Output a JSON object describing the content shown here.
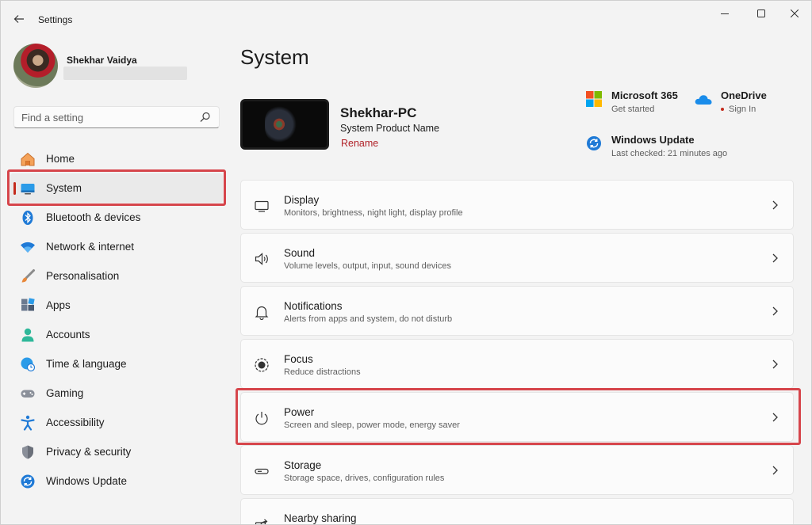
{
  "window": {
    "title": "Settings"
  },
  "profile": {
    "name": "Shekhar Vaidya"
  },
  "search": {
    "placeholder": "Find a setting"
  },
  "sidebar": {
    "items": [
      {
        "label": "Home",
        "icon": "home-icon",
        "active": false
      },
      {
        "label": "System",
        "icon": "system-icon",
        "active": true
      },
      {
        "label": "Bluetooth & devices",
        "icon": "bluetooth-icon",
        "active": false
      },
      {
        "label": "Network & internet",
        "icon": "wifi-icon",
        "active": false
      },
      {
        "label": "Personalisation",
        "icon": "brush-icon",
        "active": false
      },
      {
        "label": "Apps",
        "icon": "apps-icon",
        "active": false
      },
      {
        "label": "Accounts",
        "icon": "accounts-icon",
        "active": false
      },
      {
        "label": "Time & language",
        "icon": "clock-globe-icon",
        "active": false
      },
      {
        "label": "Gaming",
        "icon": "gamepad-icon",
        "active": false
      },
      {
        "label": "Accessibility",
        "icon": "accessibility-icon",
        "active": false
      },
      {
        "label": "Privacy & security",
        "icon": "shield-icon",
        "active": false
      },
      {
        "label": "Windows Update",
        "icon": "update-icon",
        "active": false
      }
    ]
  },
  "main": {
    "title": "System",
    "device": {
      "name": "Shekhar-PC",
      "model": "System Product Name",
      "rename": "Rename"
    },
    "quick": {
      "m365": {
        "title": "Microsoft 365",
        "subtitle": "Get started"
      },
      "onedrive": {
        "title": "OneDrive",
        "subtitle": "Sign In"
      },
      "update": {
        "title": "Windows Update",
        "subtitle": "Last checked: 21 minutes ago"
      }
    },
    "cards": [
      {
        "title": "Display",
        "subtitle": "Monitors, brightness, night light, display profile",
        "icon": "monitor-icon"
      },
      {
        "title": "Sound",
        "subtitle": "Volume levels, output, input, sound devices",
        "icon": "speaker-icon"
      },
      {
        "title": "Notifications",
        "subtitle": "Alerts from apps and system, do not disturb",
        "icon": "bell-icon"
      },
      {
        "title": "Focus",
        "subtitle": "Reduce distractions",
        "icon": "focus-icon"
      },
      {
        "title": "Power",
        "subtitle": "Screen and sleep, power mode, energy saver",
        "icon": "power-icon"
      },
      {
        "title": "Storage",
        "subtitle": "Storage space, drives, configuration rules",
        "icon": "storage-icon"
      },
      {
        "title": "Nearby sharing",
        "subtitle": "",
        "icon": "share-icon"
      }
    ]
  },
  "colors": {
    "accent": "#0067c0",
    "indicator": "#c42b1c",
    "highlight": "#d6454b",
    "link": "#b01f26"
  }
}
